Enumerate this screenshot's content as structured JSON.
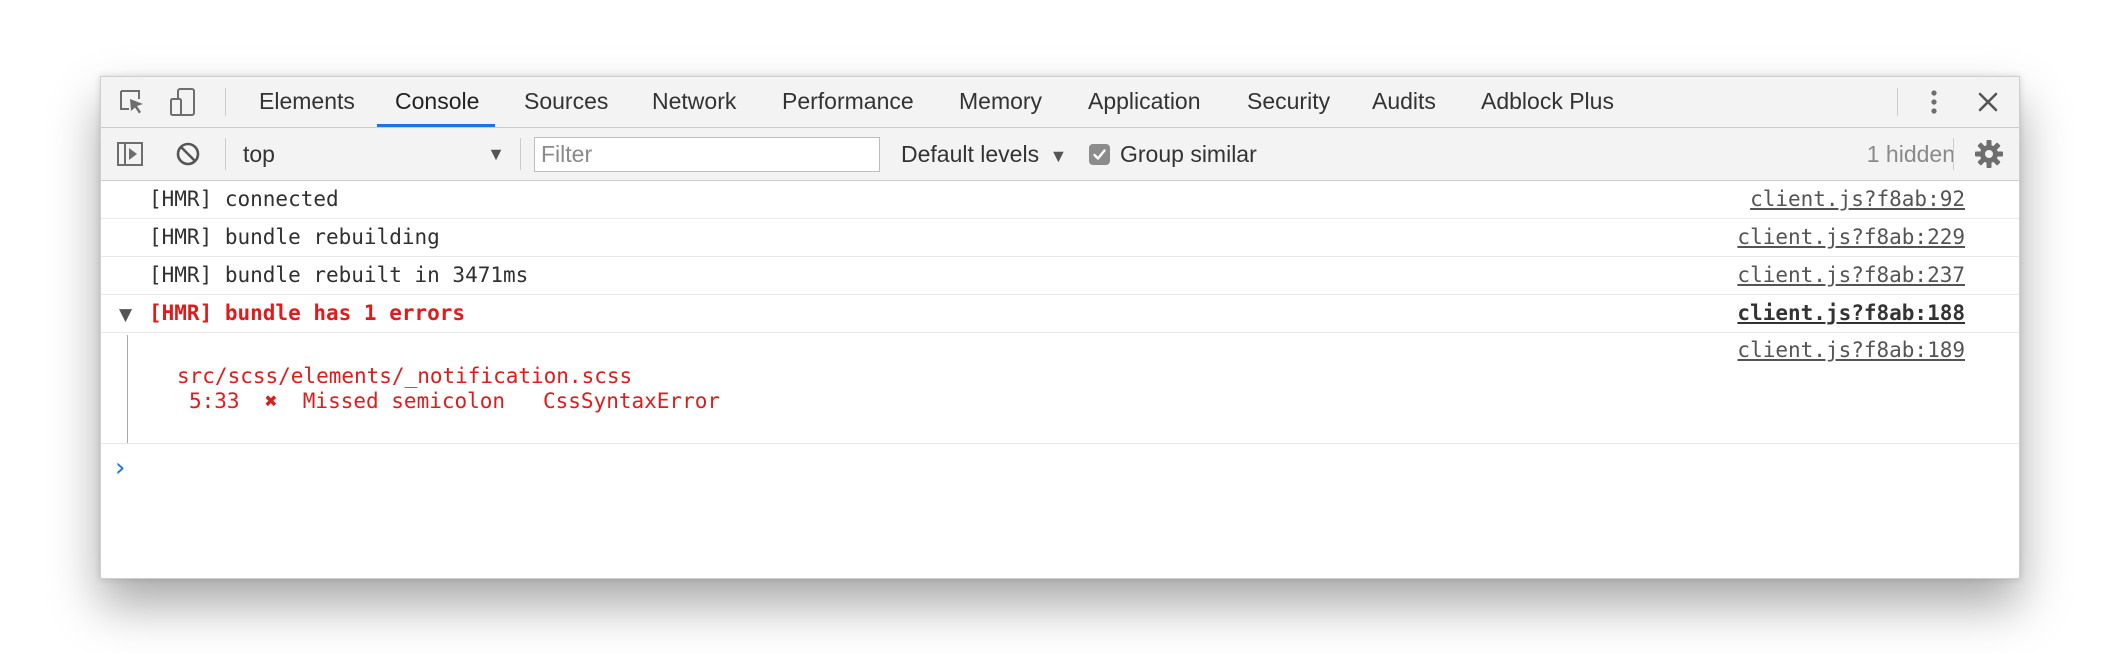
{
  "tabs": [
    {
      "label": "Elements"
    },
    {
      "label": "Console"
    },
    {
      "label": "Sources"
    },
    {
      "label": "Network"
    },
    {
      "label": "Performance"
    },
    {
      "label": "Memory"
    },
    {
      "label": "Application"
    },
    {
      "label": "Security"
    },
    {
      "label": "Audits"
    },
    {
      "label": "Adblock Plus"
    }
  ],
  "active_tab": "Console",
  "toolbar": {
    "context": "top",
    "filter_placeholder": "Filter",
    "levels_label": "Default levels",
    "group_similar_label": "Group similar",
    "group_similar_checked": true,
    "hidden_count": "1 hidden"
  },
  "icons": {
    "inspect": "inspect-element-icon",
    "device": "device-toolbar-icon",
    "more": "more-vertical-icon",
    "close": "close-icon",
    "sidebar": "show-sidebar-icon",
    "clear": "clear-console-icon",
    "settings": "gear-icon",
    "prompt": "chevron-right-icon"
  },
  "log": [
    {
      "text": "[HMR] connected",
      "source": "client.js?f8ab:92"
    },
    {
      "text": "[HMR] bundle rebuilding",
      "source": "client.js?f8ab:229"
    },
    {
      "text": "[HMR] bundle rebuilt in 3471ms",
      "source": "client.js?f8ab:237"
    }
  ],
  "error_group": {
    "title": "[HMR] bundle has 1 errors",
    "source": "client.js?f8ab:188",
    "child_source": "client.js?f8ab:189",
    "file": "src/scss/elements/_notification.scss",
    "detail": "5:33  ✖  Missed semicolon   CssSyntaxError"
  },
  "colors": {
    "accent": "#1a73e8",
    "error": "#e01b1b",
    "toolbar_bg": "#f3f3f3"
  }
}
